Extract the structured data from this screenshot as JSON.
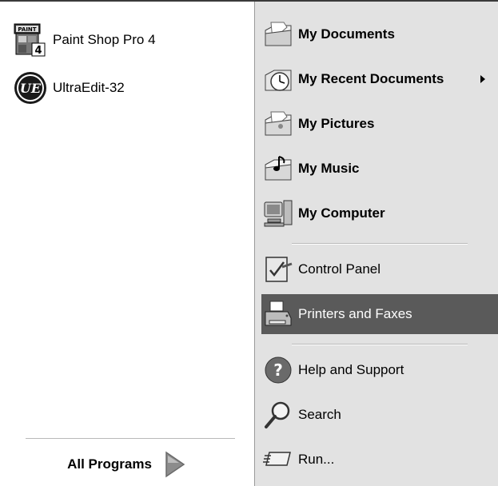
{
  "pinned": [
    {
      "label": "Paint Shop Pro 4",
      "icon": "paint-shop-pro-icon"
    },
    {
      "label": "UltraEdit-32",
      "icon": "ultraedit-icon"
    }
  ],
  "all_programs": {
    "label": "All Programs",
    "icon": "green-arrow-icon"
  },
  "places": [
    {
      "label": "My Documents",
      "icon": "my-documents-icon"
    },
    {
      "label": "My Recent Documents",
      "icon": "recent-documents-icon",
      "has_submenu": true
    },
    {
      "label": "My Pictures",
      "icon": "my-pictures-icon"
    },
    {
      "label": "My Music",
      "icon": "my-music-icon"
    },
    {
      "label": "My Computer",
      "icon": "my-computer-icon"
    }
  ],
  "settings": [
    {
      "label": "Control Panel",
      "icon": "control-panel-icon"
    },
    {
      "label": "Printers and Faxes",
      "icon": "printer-icon",
      "selected": true
    }
  ],
  "tools": [
    {
      "label": "Help and Support",
      "icon": "help-icon"
    },
    {
      "label": "Search",
      "icon": "search-icon"
    },
    {
      "label": "Run...",
      "icon": "run-icon"
    }
  ],
  "colors": {
    "selected_bg": "#5a5a5a",
    "right_panel_bg": "#e2e2e2"
  }
}
